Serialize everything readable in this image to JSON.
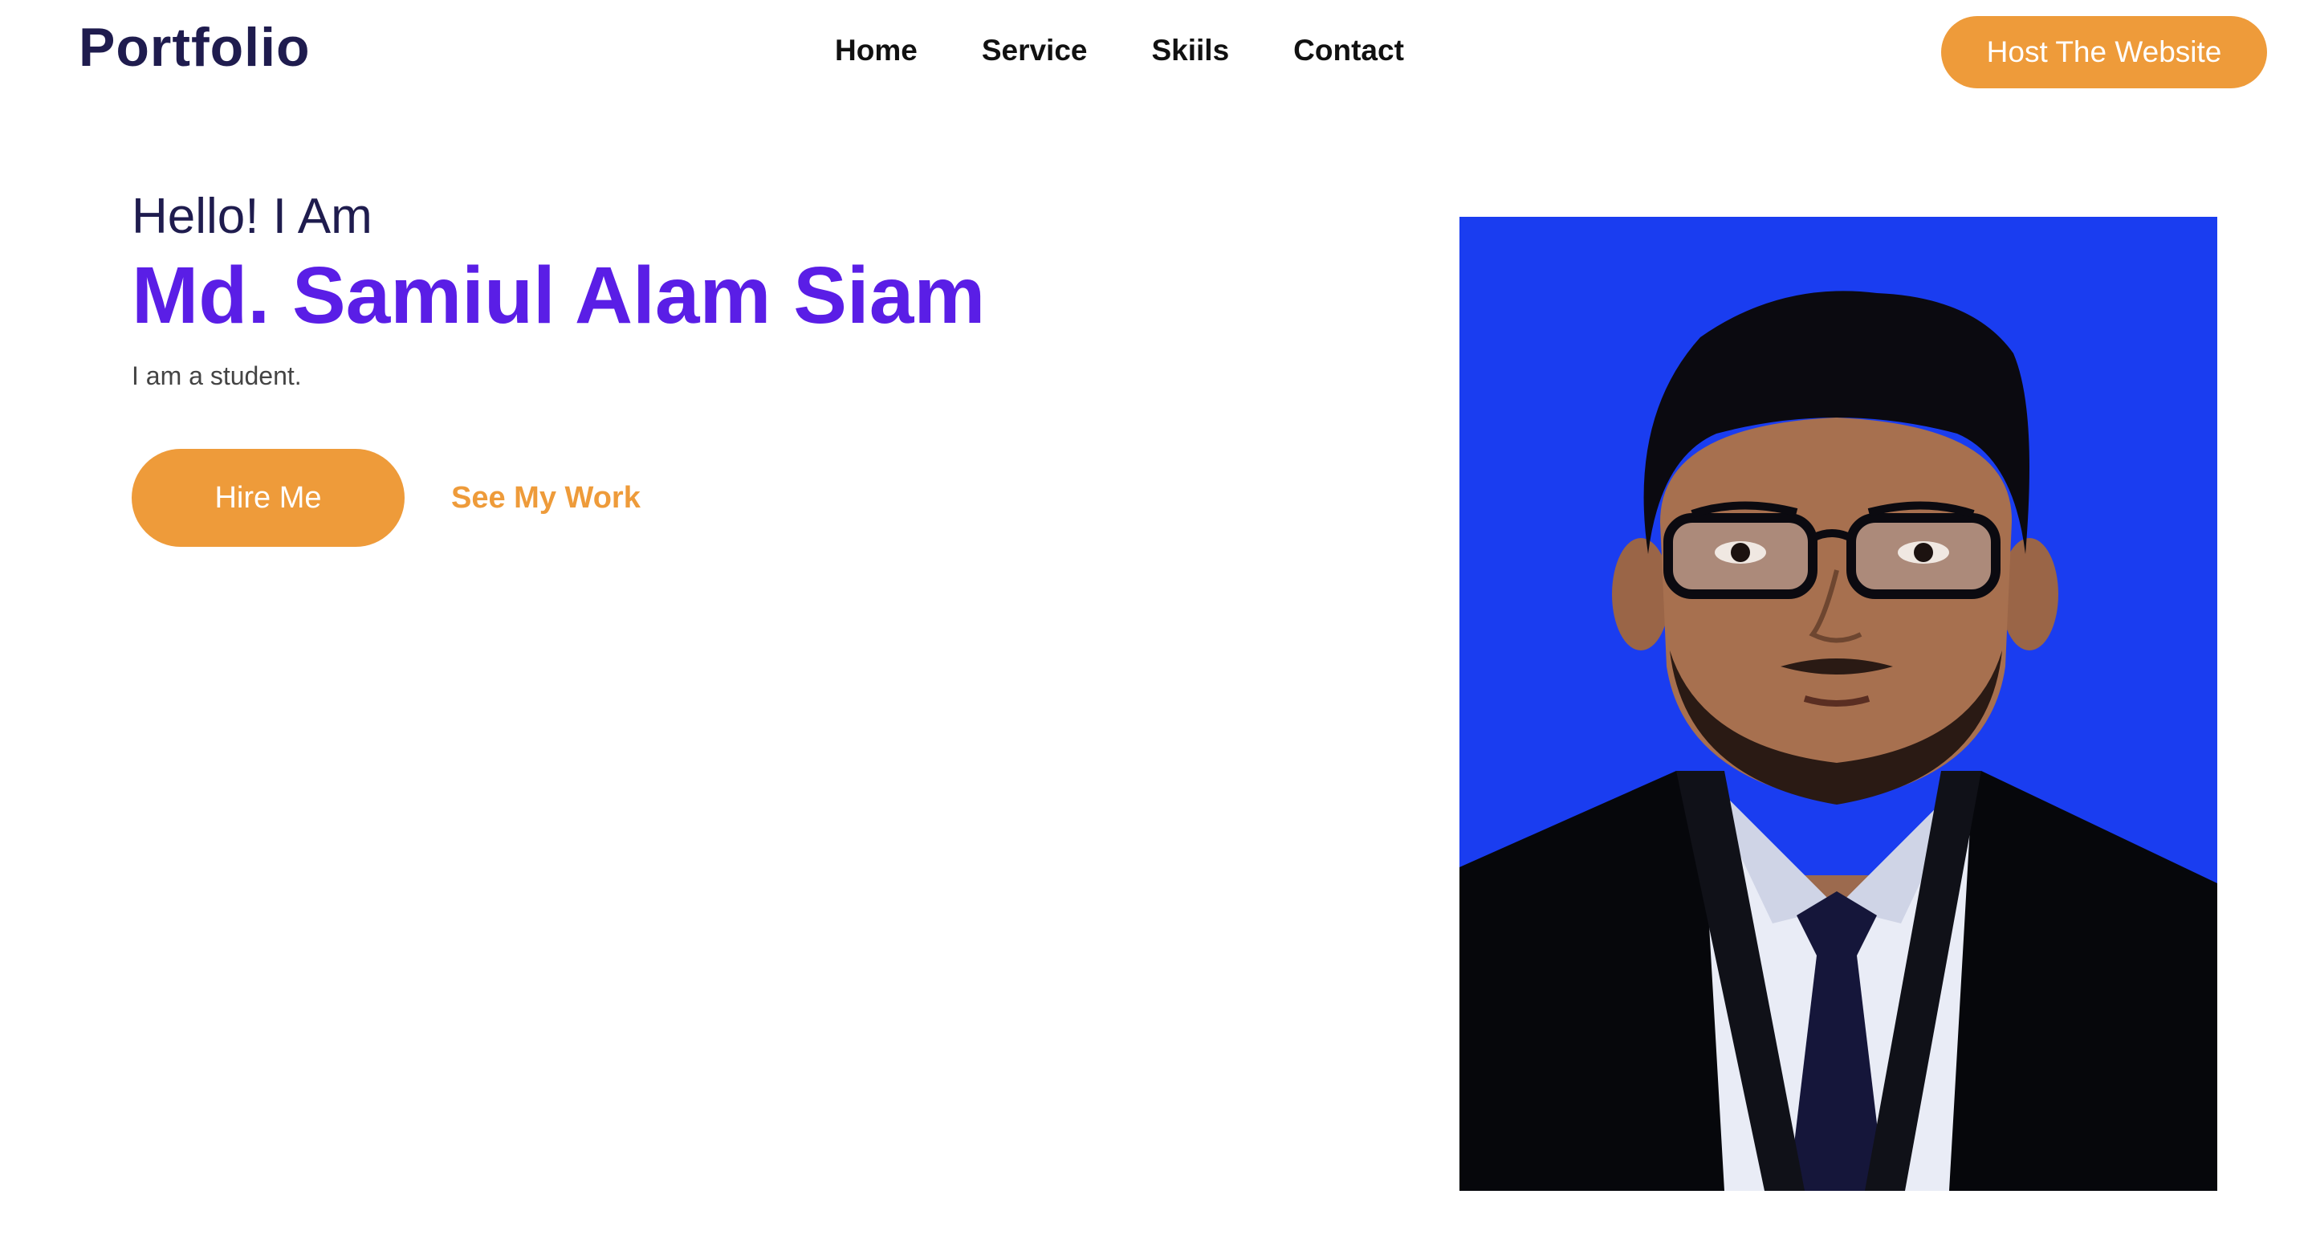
{
  "header": {
    "logo": "Portfolio",
    "nav": [
      {
        "label": "Home"
      },
      {
        "label": "Service"
      },
      {
        "label": "Skiils"
      },
      {
        "label": "Contact"
      }
    ],
    "cta_label": "Host The Website"
  },
  "hero": {
    "greeting": "Hello! I Am",
    "name": "Md. Samiul Alam Siam",
    "tagline": "I am a student.",
    "hire_label": "Hire Me",
    "work_label": "See My Work"
  },
  "portrait": {
    "alt": "Md. Samiul Alam Siam"
  },
  "colors": {
    "accent": "#ee9b3a",
    "brand_dark": "#1f1c4e",
    "name_purple": "#5a1ee6",
    "photo_background": "#1a3df0"
  }
}
